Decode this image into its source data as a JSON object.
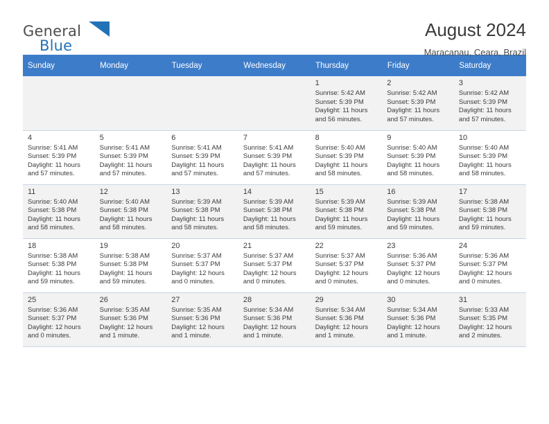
{
  "brand": {
    "name_top": "General",
    "name_bottom": "Blue",
    "flag_color": "#2272b6"
  },
  "header": {
    "title": "August 2024",
    "location": "Maracanau, Ceara, Brazil"
  },
  "calendar": {
    "weekdays": [
      "Sunday",
      "Monday",
      "Tuesday",
      "Wednesday",
      "Thursday",
      "Friday",
      "Saturday"
    ],
    "header_bg": "#3d7cc9",
    "weeks": [
      [
        {
          "day": "",
          "info": ""
        },
        {
          "day": "",
          "info": ""
        },
        {
          "day": "",
          "info": ""
        },
        {
          "day": "",
          "info": ""
        },
        {
          "day": "1",
          "info": "Sunrise: 5:42 AM\nSunset: 5:39 PM\nDaylight: 11 hours\nand 56 minutes."
        },
        {
          "day": "2",
          "info": "Sunrise: 5:42 AM\nSunset: 5:39 PM\nDaylight: 11 hours\nand 57 minutes."
        },
        {
          "day": "3",
          "info": "Sunrise: 5:42 AM\nSunset: 5:39 PM\nDaylight: 11 hours\nand 57 minutes."
        }
      ],
      [
        {
          "day": "4",
          "info": "Sunrise: 5:41 AM\nSunset: 5:39 PM\nDaylight: 11 hours\nand 57 minutes."
        },
        {
          "day": "5",
          "info": "Sunrise: 5:41 AM\nSunset: 5:39 PM\nDaylight: 11 hours\nand 57 minutes."
        },
        {
          "day": "6",
          "info": "Sunrise: 5:41 AM\nSunset: 5:39 PM\nDaylight: 11 hours\nand 57 minutes."
        },
        {
          "day": "7",
          "info": "Sunrise: 5:41 AM\nSunset: 5:39 PM\nDaylight: 11 hours\nand 57 minutes."
        },
        {
          "day": "8",
          "info": "Sunrise: 5:40 AM\nSunset: 5:39 PM\nDaylight: 11 hours\nand 58 minutes."
        },
        {
          "day": "9",
          "info": "Sunrise: 5:40 AM\nSunset: 5:39 PM\nDaylight: 11 hours\nand 58 minutes."
        },
        {
          "day": "10",
          "info": "Sunrise: 5:40 AM\nSunset: 5:39 PM\nDaylight: 11 hours\nand 58 minutes."
        }
      ],
      [
        {
          "day": "11",
          "info": "Sunrise: 5:40 AM\nSunset: 5:38 PM\nDaylight: 11 hours\nand 58 minutes."
        },
        {
          "day": "12",
          "info": "Sunrise: 5:40 AM\nSunset: 5:38 PM\nDaylight: 11 hours\nand 58 minutes."
        },
        {
          "day": "13",
          "info": "Sunrise: 5:39 AM\nSunset: 5:38 PM\nDaylight: 11 hours\nand 58 minutes."
        },
        {
          "day": "14",
          "info": "Sunrise: 5:39 AM\nSunset: 5:38 PM\nDaylight: 11 hours\nand 58 minutes."
        },
        {
          "day": "15",
          "info": "Sunrise: 5:39 AM\nSunset: 5:38 PM\nDaylight: 11 hours\nand 59 minutes."
        },
        {
          "day": "16",
          "info": "Sunrise: 5:39 AM\nSunset: 5:38 PM\nDaylight: 11 hours\nand 59 minutes."
        },
        {
          "day": "17",
          "info": "Sunrise: 5:38 AM\nSunset: 5:38 PM\nDaylight: 11 hours\nand 59 minutes."
        }
      ],
      [
        {
          "day": "18",
          "info": "Sunrise: 5:38 AM\nSunset: 5:38 PM\nDaylight: 11 hours\nand 59 minutes."
        },
        {
          "day": "19",
          "info": "Sunrise: 5:38 AM\nSunset: 5:38 PM\nDaylight: 11 hours\nand 59 minutes."
        },
        {
          "day": "20",
          "info": "Sunrise: 5:37 AM\nSunset: 5:37 PM\nDaylight: 12 hours\nand 0 minutes."
        },
        {
          "day": "21",
          "info": "Sunrise: 5:37 AM\nSunset: 5:37 PM\nDaylight: 12 hours\nand 0 minutes."
        },
        {
          "day": "22",
          "info": "Sunrise: 5:37 AM\nSunset: 5:37 PM\nDaylight: 12 hours\nand 0 minutes."
        },
        {
          "day": "23",
          "info": "Sunrise: 5:36 AM\nSunset: 5:37 PM\nDaylight: 12 hours\nand 0 minutes."
        },
        {
          "day": "24",
          "info": "Sunrise: 5:36 AM\nSunset: 5:37 PM\nDaylight: 12 hours\nand 0 minutes."
        }
      ],
      [
        {
          "day": "25",
          "info": "Sunrise: 5:36 AM\nSunset: 5:37 PM\nDaylight: 12 hours\nand 0 minutes."
        },
        {
          "day": "26",
          "info": "Sunrise: 5:35 AM\nSunset: 5:36 PM\nDaylight: 12 hours\nand 1 minute."
        },
        {
          "day": "27",
          "info": "Sunrise: 5:35 AM\nSunset: 5:36 PM\nDaylight: 12 hours\nand 1 minute."
        },
        {
          "day": "28",
          "info": "Sunrise: 5:34 AM\nSunset: 5:36 PM\nDaylight: 12 hours\nand 1 minute."
        },
        {
          "day": "29",
          "info": "Sunrise: 5:34 AM\nSunset: 5:36 PM\nDaylight: 12 hours\nand 1 minute."
        },
        {
          "day": "30",
          "info": "Sunrise: 5:34 AM\nSunset: 5:36 PM\nDaylight: 12 hours\nand 1 minute."
        },
        {
          "day": "31",
          "info": "Sunrise: 5:33 AM\nSunset: 5:35 PM\nDaylight: 12 hours\nand 2 minutes."
        }
      ]
    ]
  }
}
